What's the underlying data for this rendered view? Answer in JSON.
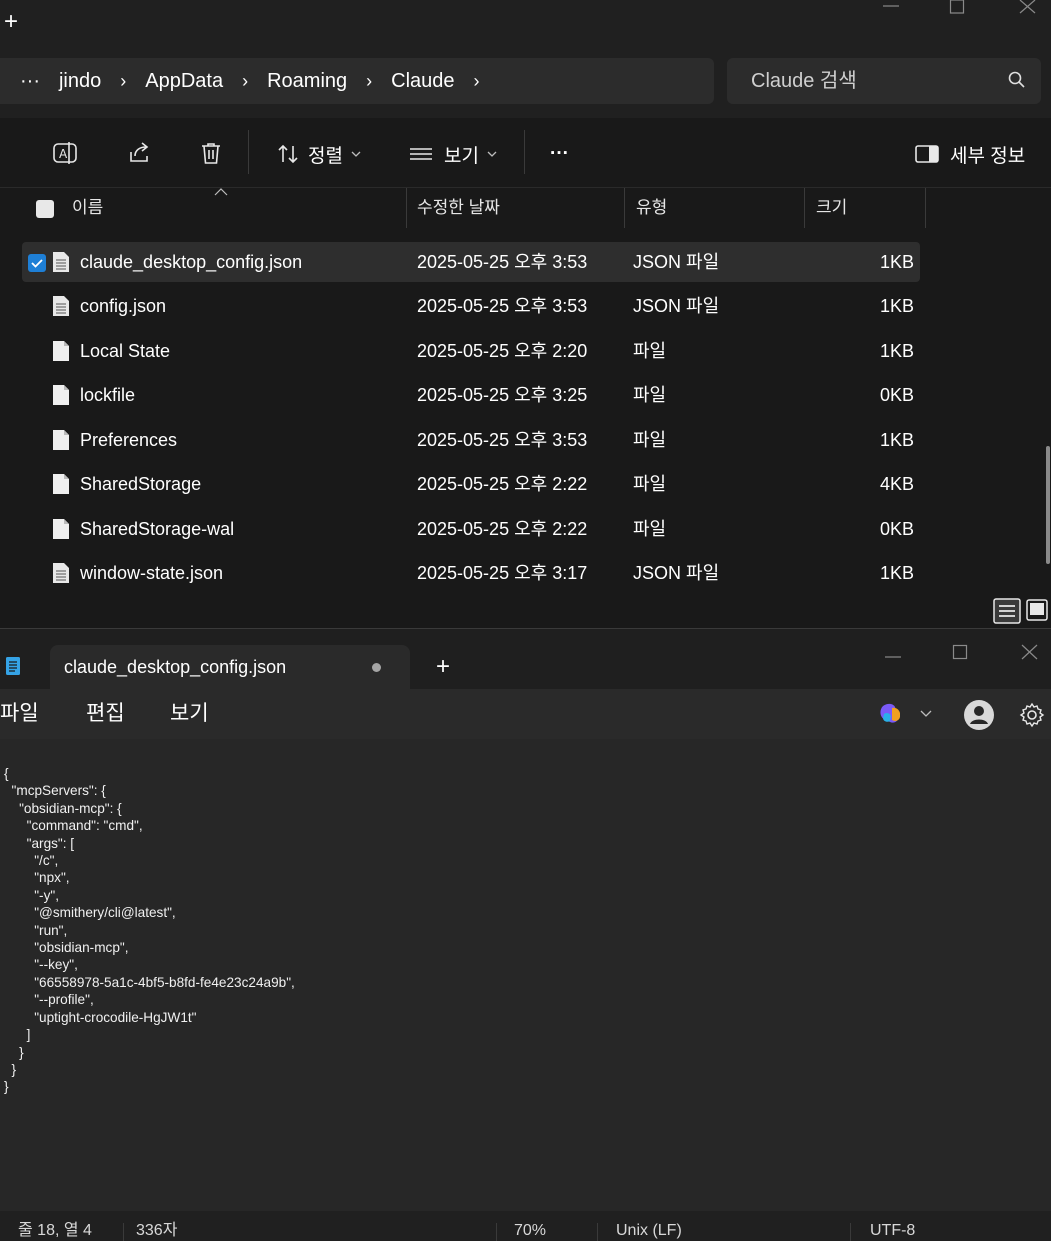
{
  "explorer": {
    "new_tab_symbol": "+",
    "breadcrumb": {
      "overflow": "···",
      "items": [
        "jindo",
        "AppData",
        "Roaming",
        "Claude"
      ],
      "separator": "›"
    },
    "search": {
      "placeholder": "Claude 검색"
    },
    "toolbar": {
      "sort_label": "정렬",
      "view_label": "보기",
      "more_label": "···",
      "details_label": "세부 정보"
    },
    "columns": {
      "name": "이름",
      "date": "수정한 날짜",
      "type": "유형",
      "size": "크기"
    },
    "files": [
      {
        "name": "claude_desktop_config.json",
        "date": "2025-05-25 오후 3:53",
        "type": "JSON 파일",
        "size": "1KB",
        "selected": true,
        "icon": "json-file-icon"
      },
      {
        "name": "config.json",
        "date": "2025-05-25 오후 3:53",
        "type": "JSON 파일",
        "size": "1KB",
        "selected": false,
        "icon": "json-file-icon"
      },
      {
        "name": "Local State",
        "date": "2025-05-25 오후 2:20",
        "type": "파일",
        "size": "1KB",
        "selected": false,
        "icon": "blank-file-icon"
      },
      {
        "name": "lockfile",
        "date": "2025-05-25 오후 3:25",
        "type": "파일",
        "size": "0KB",
        "selected": false,
        "icon": "blank-file-icon"
      },
      {
        "name": "Preferences",
        "date": "2025-05-25 오후 3:53",
        "type": "파일",
        "size": "1KB",
        "selected": false,
        "icon": "blank-file-icon"
      },
      {
        "name": "SharedStorage",
        "date": "2025-05-25 오후 2:22",
        "type": "파일",
        "size": "4KB",
        "selected": false,
        "icon": "blank-file-icon"
      },
      {
        "name": "SharedStorage-wal",
        "date": "2025-05-25 오후 2:22",
        "type": "파일",
        "size": "0KB",
        "selected": false,
        "icon": "blank-file-icon"
      },
      {
        "name": "window-state.json",
        "date": "2025-05-25 오후 3:17",
        "type": "JSON 파일",
        "size": "1KB",
        "selected": false,
        "icon": "json-file-icon"
      }
    ]
  },
  "notepad": {
    "tab_title": "claude_desktop_config.json",
    "new_tab_symbol": "+",
    "menu": {
      "file": "파일",
      "edit": "편집",
      "view": "보기"
    },
    "content": "{\n  \"mcpServers\": {\n    \"obsidian-mcp\": {\n      \"command\": \"cmd\",\n      \"args\": [\n        \"/c\",\n        \"npx\",\n        \"-y\",\n        \"@smithery/cli@latest\",\n        \"run\",\n        \"obsidian-mcp\",\n        \"--key\",\n        \"66558978-5a1c-4bf5-b8fd-fe4e23c24a9b\",\n        \"--profile\",\n        \"uptight-crocodile-HgJW1t\"\n      ]\n    }\n  }\n}",
    "status": {
      "position": "줄 18, 열 4",
      "char_count": "336자",
      "zoom": "70%",
      "line_ending": "Unix (LF)",
      "encoding": "UTF-8"
    }
  },
  "colors": {
    "accent": "#1e7fd6",
    "background": "#191919",
    "notepad_bg": "#272727"
  }
}
